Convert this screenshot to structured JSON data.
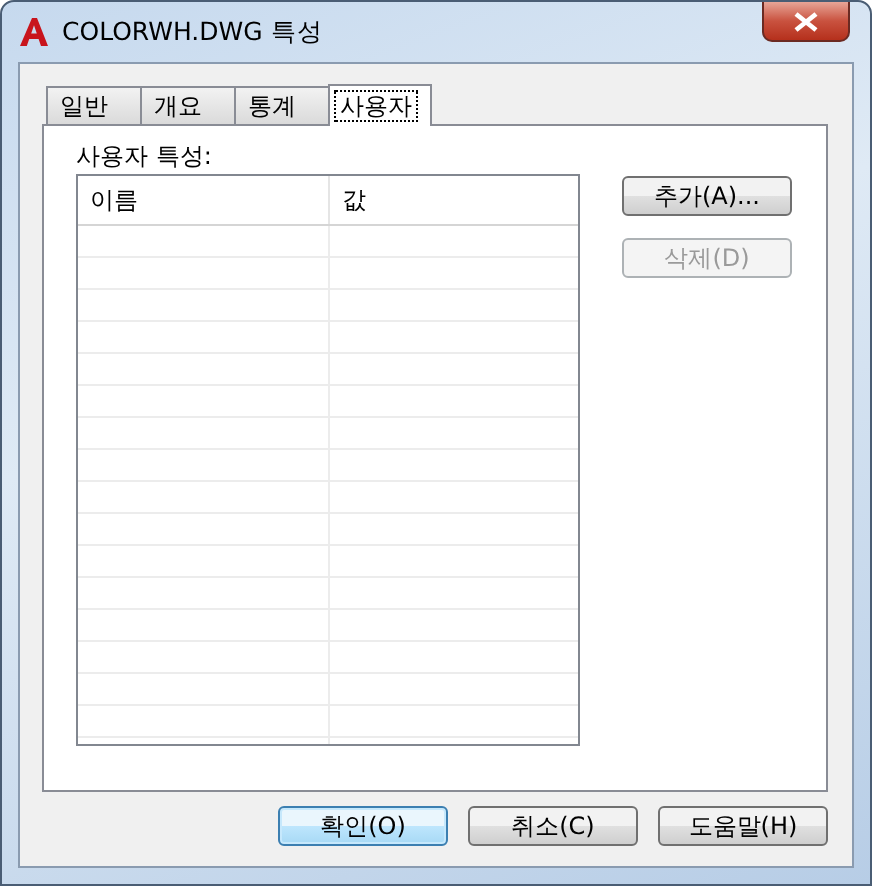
{
  "window": {
    "title": "COLORWH.DWG 특성"
  },
  "tabs": [
    {
      "label": "일반",
      "selected": false
    },
    {
      "label": "개요",
      "selected": false
    },
    {
      "label": "통계",
      "selected": false
    },
    {
      "label": "사용자",
      "selected": true
    }
  ],
  "section_label": "사용자 특성:",
  "table": {
    "columns": [
      "이름",
      "값"
    ]
  },
  "side_buttons": [
    {
      "label": "추가(A)...",
      "disabled": false
    },
    {
      "label": "삭제(D)",
      "disabled": true
    }
  ],
  "buttons": [
    {
      "label": "확인(O)",
      "default": true
    },
    {
      "label": "취소(C)",
      "default": false
    },
    {
      "label": "도움말(H)",
      "default": false
    }
  ]
}
